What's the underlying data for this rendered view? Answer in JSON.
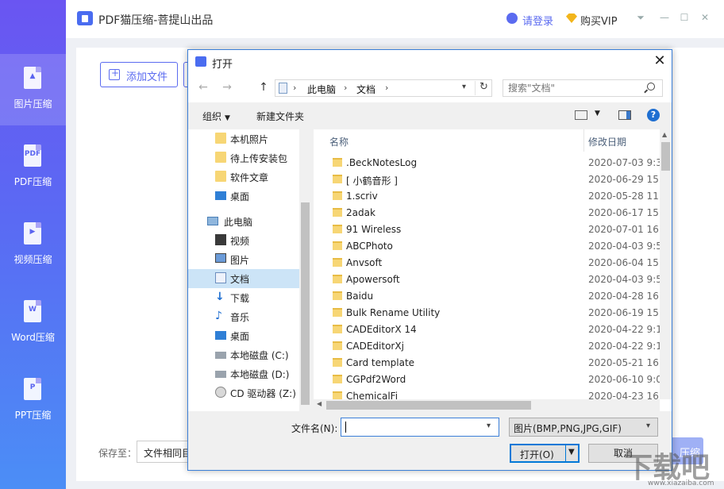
{
  "app": {
    "title": "PDF猫压缩-菩提山出品",
    "login": "请登录",
    "vip": "购买VIP",
    "window_controls": [
      "⏷",
      "—",
      "☐",
      "✕"
    ]
  },
  "sidebar": {
    "items": [
      {
        "label": "图片压缩",
        "glyph": "▲",
        "active": true
      },
      {
        "label": "PDF压缩",
        "glyph": "PDF",
        "active": false
      },
      {
        "label": "视频压缩",
        "glyph": "▶",
        "active": false
      },
      {
        "label": "Word压缩",
        "glyph": "W",
        "active": false
      },
      {
        "label": "PPT压缩",
        "glyph": "P",
        "active": false
      }
    ]
  },
  "main": {
    "add_file": "添加文件",
    "save_to_label": "保存至：",
    "save_to_value": "文件相同目录",
    "start_button": "压缩"
  },
  "dialog": {
    "title": "打开",
    "close": "✕",
    "nav": {
      "back": "←",
      "forward": "→",
      "up": "↑"
    },
    "breadcrumb": [
      "此电脑",
      "文档"
    ],
    "refresh": "↻",
    "search_placeholder": "搜索\"文档\"",
    "toolbar": {
      "organize": "组织",
      "new_folder": "新建文件夹",
      "help": "?"
    },
    "nav_pane": [
      {
        "label": "本机照片",
        "icon": "folder-icon"
      },
      {
        "label": "待上传安装包",
        "icon": "folder-icon"
      },
      {
        "label": "软件文章",
        "icon": "folder-icon"
      },
      {
        "label": "桌面",
        "icon": "desktop-icon"
      },
      {
        "label": "此电脑",
        "icon": "pc-icon"
      },
      {
        "label": "视频",
        "icon": "video-icon"
      },
      {
        "label": "图片",
        "icon": "picture-icon"
      },
      {
        "label": "文档",
        "icon": "document-icon",
        "selected": true
      },
      {
        "label": "下载",
        "icon": "download-icon"
      },
      {
        "label": "音乐",
        "icon": "music-icon"
      },
      {
        "label": "桌面",
        "icon": "desktop-icon"
      },
      {
        "label": "本地磁盘 (C:)",
        "icon": "disk-icon"
      },
      {
        "label": "本地磁盘 (D:)",
        "icon": "disk-icon"
      },
      {
        "label": "CD 驱动器 (Z:)",
        "icon": "cd-icon"
      }
    ],
    "columns": {
      "name": "名称",
      "date": "修改日期"
    },
    "files": [
      {
        "name": ".BeckNotesLog",
        "date": "2020-07-03 9:3"
      },
      {
        "name": "[ 小鹤音形 ]",
        "date": "2020-06-29 15:"
      },
      {
        "name": "1.scriv",
        "date": "2020-05-28 11:"
      },
      {
        "name": "2adak",
        "date": "2020-06-17 15:"
      },
      {
        "name": "91 Wireless",
        "date": "2020-07-01 16:"
      },
      {
        "name": "ABCPhoto",
        "date": "2020-04-03 9:5"
      },
      {
        "name": "Anvsoft",
        "date": "2020-06-04 15:"
      },
      {
        "name": "Apowersoft",
        "date": "2020-04-03 9:5"
      },
      {
        "name": "Baidu",
        "date": "2020-04-28 16:"
      },
      {
        "name": "Bulk Rename Utility",
        "date": "2020-06-19 15:"
      },
      {
        "name": "CADEditorX 14",
        "date": "2020-04-22 9:1"
      },
      {
        "name": "CADEditorXj",
        "date": "2020-04-22 9:1"
      },
      {
        "name": "Card template",
        "date": "2020-05-21 16:"
      },
      {
        "name": "CGPdf2Word",
        "date": "2020-06-10 9:0"
      },
      {
        "name": "ChemicalFi",
        "date": "2020-04-23 16:"
      }
    ],
    "filename_label": "文件名(N):",
    "filename_value": "",
    "file_type": "图片(BMP,PNG,JPG,GIF)",
    "open_button": "打开(O)",
    "cancel_button": "取消"
  },
  "watermark": {
    "main": "下载吧",
    "sub": "www.xiazaiba.com"
  },
  "colors": {
    "accent": "#5b6bf0",
    "selection": "#cce4f7",
    "folder": "#f7d675"
  }
}
